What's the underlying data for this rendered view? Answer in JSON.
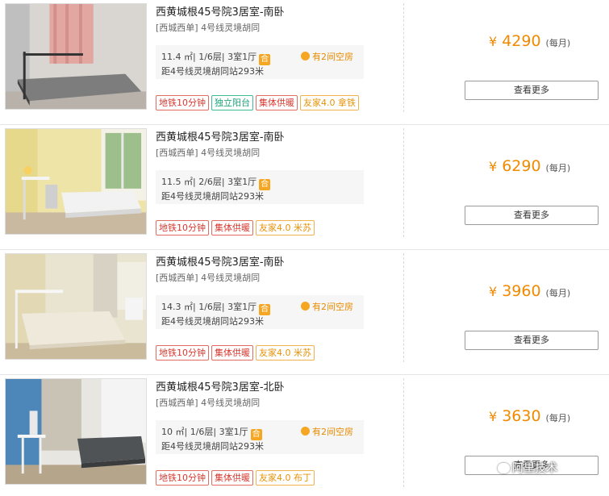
{
  "listings": [
    {
      "title": "西黄城根45号院3居室-南卧",
      "subtitle": "[西城西单] 4号线灵境胡同",
      "specs": "11.4 ㎡| 1/6层| 3室1厅",
      "shared_badge": "合",
      "vacancy": "有2间空房",
      "distance": "距4号线灵境胡同站293米",
      "tags": [
        {
          "text": "地铁10分钟",
          "color": "red"
        },
        {
          "text": "独立阳台",
          "color": "green"
        },
        {
          "text": "集体供暖",
          "color": "red"
        },
        {
          "text": "友家4.0 拿铁",
          "color": "orange"
        }
      ],
      "currency": "¥",
      "price": "4290",
      "period": "(每月)",
      "button": "查看更多",
      "photo_icon": "bedroom-photo-pink-curtain"
    },
    {
      "title": "西黄城根45号院3居室-南卧",
      "subtitle": "[西城西单] 4号线灵境胡同",
      "specs": "11.5 ㎡| 2/6层| 3室1厅",
      "shared_badge": "合",
      "vacancy": "",
      "distance": "距4号线灵境胡同站293米",
      "tags": [
        {
          "text": "地铁10分钟",
          "color": "red"
        },
        {
          "text": "集体供暖",
          "color": "red"
        },
        {
          "text": "友家4.0 米苏",
          "color": "orange"
        }
      ],
      "currency": "¥",
      "price": "6290",
      "period": "(每月)",
      "button": "查看更多",
      "photo_icon": "bedroom-photo-yellow-wall-window"
    },
    {
      "title": "西黄城根45号院3居室-南卧",
      "subtitle": "[西城西单] 4号线灵境胡同",
      "specs": "14.3 ㎡| 1/6层| 3室1厅",
      "shared_badge": "合",
      "vacancy": "有2间空房",
      "distance": "距4号线灵境胡同站293米",
      "tags": [
        {
          "text": "地铁10分钟",
          "color": "red"
        },
        {
          "text": "集体供暖",
          "color": "red"
        },
        {
          "text": "友家4.0 米苏",
          "color": "orange"
        }
      ],
      "currency": "¥",
      "price": "3960",
      "period": "(每月)",
      "button": "查看更多",
      "photo_icon": "bedroom-photo-white-bed"
    },
    {
      "title": "西黄城根45号院3居室-北卧",
      "subtitle": "[西城西单] 4号线灵境胡同",
      "specs": "10 ㎡| 1/6层| 3室1厅",
      "shared_badge": "合",
      "vacancy": "有2间空房",
      "distance": "距4号线灵境胡同站293米",
      "tags": [
        {
          "text": "地铁10分钟",
          "color": "red"
        },
        {
          "text": "集体供暖",
          "color": "red"
        },
        {
          "text": "友家4.0 布丁",
          "color": "orange"
        }
      ],
      "currency": "¥",
      "price": "3630",
      "period": "(每月)",
      "button": "查看更多",
      "photo_icon": "bedroom-photo-blue-wall"
    }
  ],
  "watermark": "阿里技术",
  "colors": {
    "accent": "#f08a00",
    "badge": "#f5a623",
    "tag_red": "#d9382f",
    "tag_green": "#1fa37a",
    "tag_orange": "#e6930b"
  }
}
